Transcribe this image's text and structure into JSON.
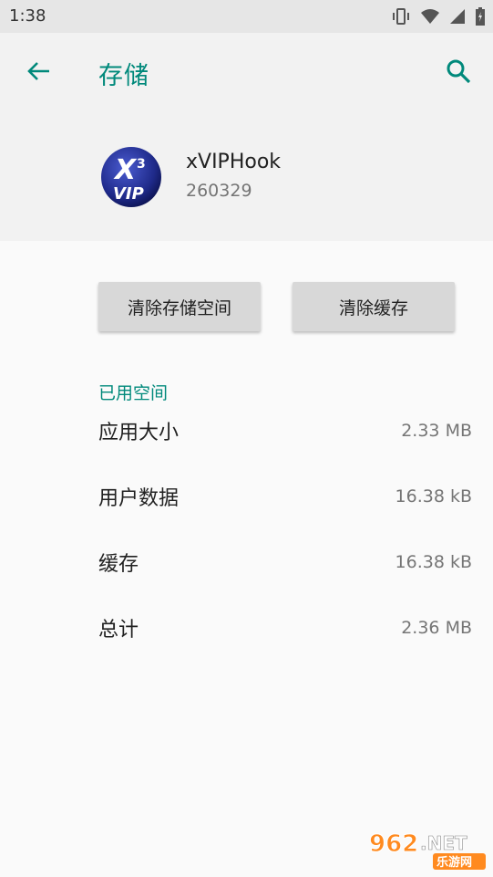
{
  "status_bar": {
    "time": "1:38",
    "icons": [
      "vibrate-icon",
      "wifi-icon",
      "signal-icon",
      "battery-icon"
    ]
  },
  "app_bar": {
    "back_icon": "back-arrow-icon",
    "title": "存储",
    "search_icon": "search-icon"
  },
  "app_info": {
    "name": "xVIPHook",
    "version": "260329"
  },
  "actions": {
    "clear_storage": "清除存储空间",
    "clear_cache": "清除缓存"
  },
  "storage": {
    "section_label": "已用空间",
    "rows": [
      {
        "label": "应用大小",
        "value": "2.33 MB"
      },
      {
        "label": "用户数据",
        "value": "16.38 kB"
      },
      {
        "label": "缓存",
        "value": "16.38 kB"
      },
      {
        "label": "总计",
        "value": "2.36 MB"
      }
    ]
  },
  "watermark": {
    "brand": "962.NET",
    "sub": "乐游网"
  },
  "colors": {
    "accent": "#00897b",
    "background": "#fafafa",
    "header_bg": "#f2f2f2",
    "button_bg": "#d8d8d8"
  }
}
